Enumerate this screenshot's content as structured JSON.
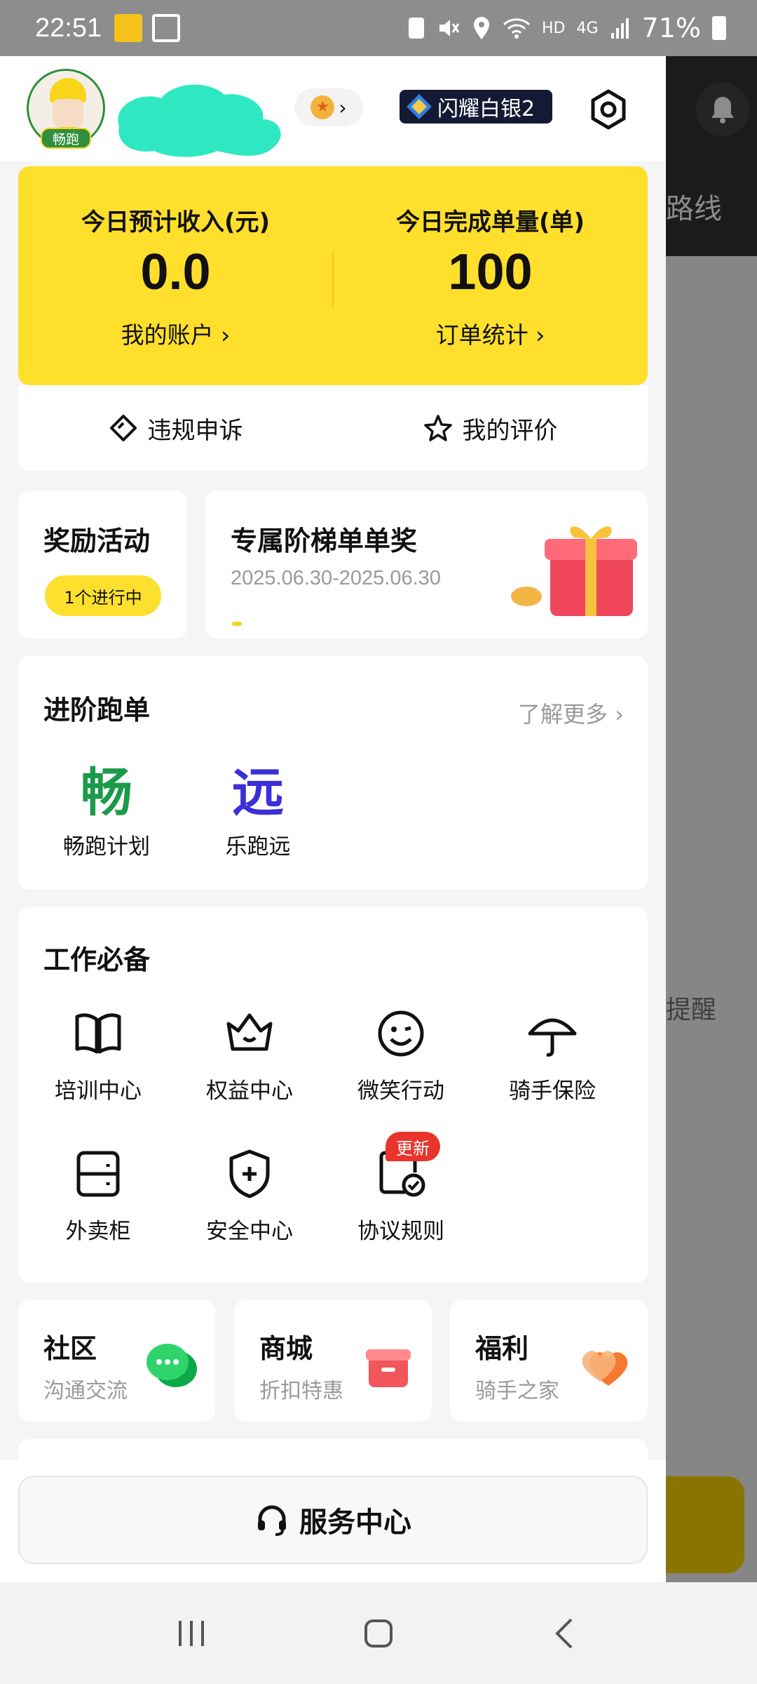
{
  "status_bar": {
    "time": "22:51",
    "network": "HD",
    "network2": "4G",
    "battery": "71%"
  },
  "header": {
    "avatar_badge": "畅跑",
    "rank_label": "闪耀白银2"
  },
  "stats": {
    "income_label": "今日预计收入(元)",
    "income_value": "0.0",
    "income_link": "我的账户 ›",
    "orders_label": "今日完成单量(单)",
    "orders_value": "100",
    "orders_link": "订单统计 ›"
  },
  "actions": {
    "appeal": "违规申诉",
    "rating": "我的评价"
  },
  "reward": {
    "title": "奖励活动",
    "badge": "1个进行中"
  },
  "promo": {
    "title": "专属阶梯单单奖",
    "date": "2025.06.30-2025.06.30"
  },
  "advance": {
    "title": "进阶跑单",
    "more": "了解更多 ›",
    "items": [
      {
        "glyph": "畅",
        "name": "畅跑计划",
        "color": "#1a9a4a"
      },
      {
        "glyph": "远",
        "name": "乐跑远",
        "color": "#3a2fd8"
      }
    ]
  },
  "tools": {
    "title": "工作必备",
    "items": [
      {
        "name": "培训中心",
        "icon": "book-icon"
      },
      {
        "name": "权益中心",
        "icon": "crown-icon"
      },
      {
        "name": "微笑行动",
        "icon": "smile-icon"
      },
      {
        "name": "骑手保险",
        "icon": "umbrella-icon"
      },
      {
        "name": "外卖柜",
        "icon": "locker-icon"
      },
      {
        "name": "安全中心",
        "icon": "shield-icon"
      },
      {
        "name": "协议规则",
        "icon": "agreement-icon"
      }
    ],
    "new_badge": "更新"
  },
  "shortcuts": [
    {
      "title": "社区",
      "sub": "沟通交流",
      "icon": "chat-icon",
      "color": "#1fbf5a"
    },
    {
      "title": "商城",
      "sub": "折扣特惠",
      "icon": "gift-box-icon",
      "color": "#f0565a"
    },
    {
      "title": "福利",
      "sub": "骑手之家",
      "icon": "heart-icon",
      "color": "#f47a2e"
    }
  ],
  "service": {
    "label": "服务中心"
  },
  "background": {
    "route_text": "路线",
    "remind_text": "提醒"
  },
  "colors": {
    "accent_yellow": "#fddf2c",
    "page_bg": "#f5f5f5",
    "dim_overlay": "#8d8d8d"
  }
}
